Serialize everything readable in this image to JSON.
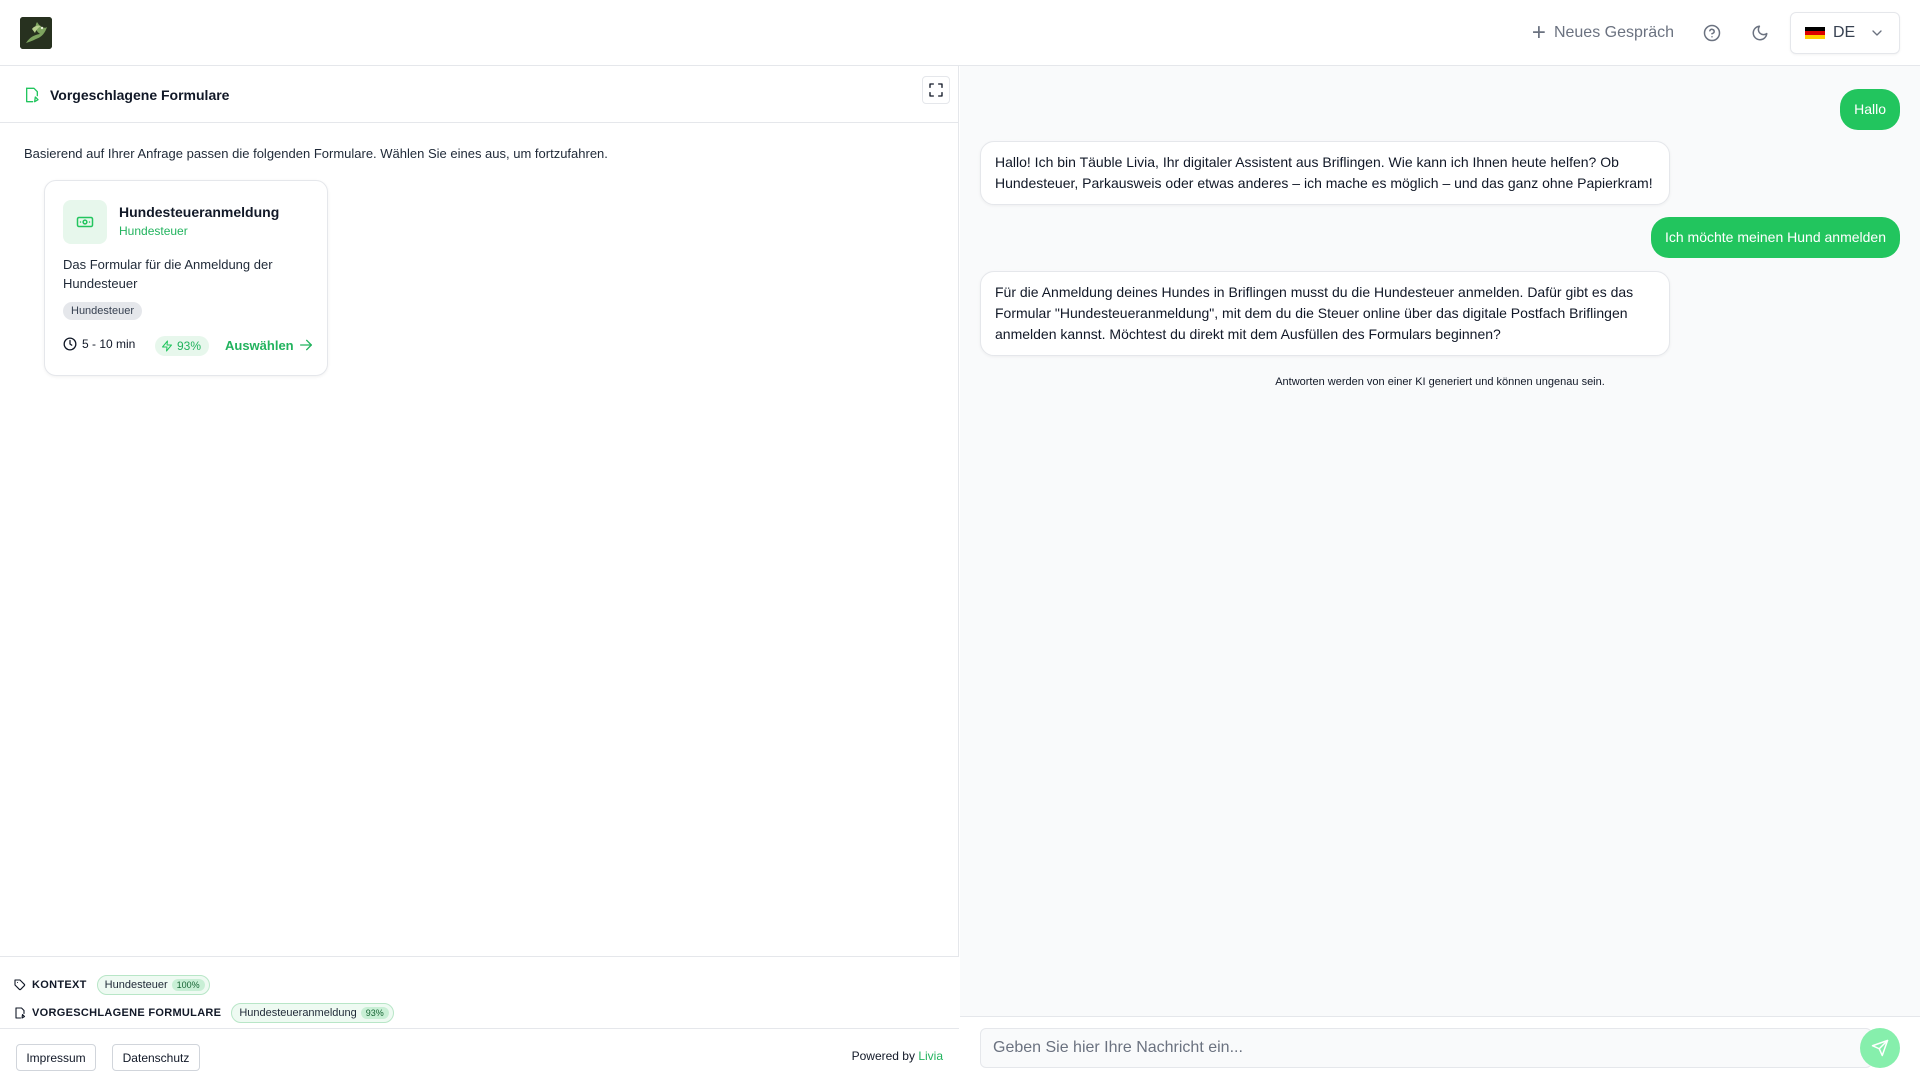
{
  "header": {
    "new_chat_label": "Neues Gespräch",
    "language": "DE",
    "icons": [
      "logo",
      "plus-icon",
      "help-icon",
      "moon-icon",
      "german-flag-icon",
      "chevron-down-icon"
    ]
  },
  "forms_panel": {
    "title": "Vorgeschlagene Formulare",
    "intro": "Basierend auf Ihrer Anfrage passen die folgenden Formulare. Wählen Sie eines aus, um fortzufahren.",
    "cards": [
      {
        "title": "Hundesteueranmeldung",
        "category": "Hundesteuer",
        "description": "Das Formular für die Anmeldung der Hundesteuer",
        "tag": "Hundesteuer",
        "duration": "5 - 10 min",
        "match": "93%",
        "select_label": "Auswählen"
      }
    ]
  },
  "context_bar": {
    "context_label": "KONTEXT",
    "context_chip": {
      "label": "Hundesteuer",
      "pct": "100%"
    },
    "forms_label": "VORGESCHLAGENE FORMULARE",
    "forms_chip": {
      "label": "Hundesteueranmeldung",
      "pct": "93%"
    }
  },
  "footer": {
    "impressum": "Impressum",
    "datenschutz": "Datenschutz",
    "powered_by": "Powered by",
    "brand": "Livia"
  },
  "chat": {
    "messages": [
      {
        "role": "user",
        "text": "Hallo"
      },
      {
        "role": "assistant",
        "text": "Hallo! Ich bin Täuble Livia, Ihr digitaler Assistent aus Briflingen. Wie kann ich Ihnen heute helfen? Ob Hundesteuer, Parkausweis oder etwas anderes – ich mache es möglich – und das ganz ohne Papierkram!"
      },
      {
        "role": "user",
        "text": "Ich möchte meinen Hund anmelden"
      },
      {
        "role": "assistant",
        "text": "Für die Anmeldung deines Hundes in Briflingen musst du die Hundesteuer anmelden. Dafür gibt es das Formular \"Hundesteueranmeldung\", mit dem du die Steuer online über das digitale Postfach Briflingen anmelden kannst. Möchtest du direkt mit dem Ausfüllen des Formulars beginnen?"
      }
    ],
    "disclaimer": "Antworten werden von einer KI generiert und können ungenau sein.",
    "input_placeholder": "Geben Sie hier Ihre Nachricht ein...",
    "input_value": ""
  },
  "colors": {
    "accent": "#22c55e",
    "accent_text": "#22b35e",
    "accent_light": "#e7f7ec",
    "border": "#e5e7eb",
    "chat_bg": "#f9fafb"
  }
}
